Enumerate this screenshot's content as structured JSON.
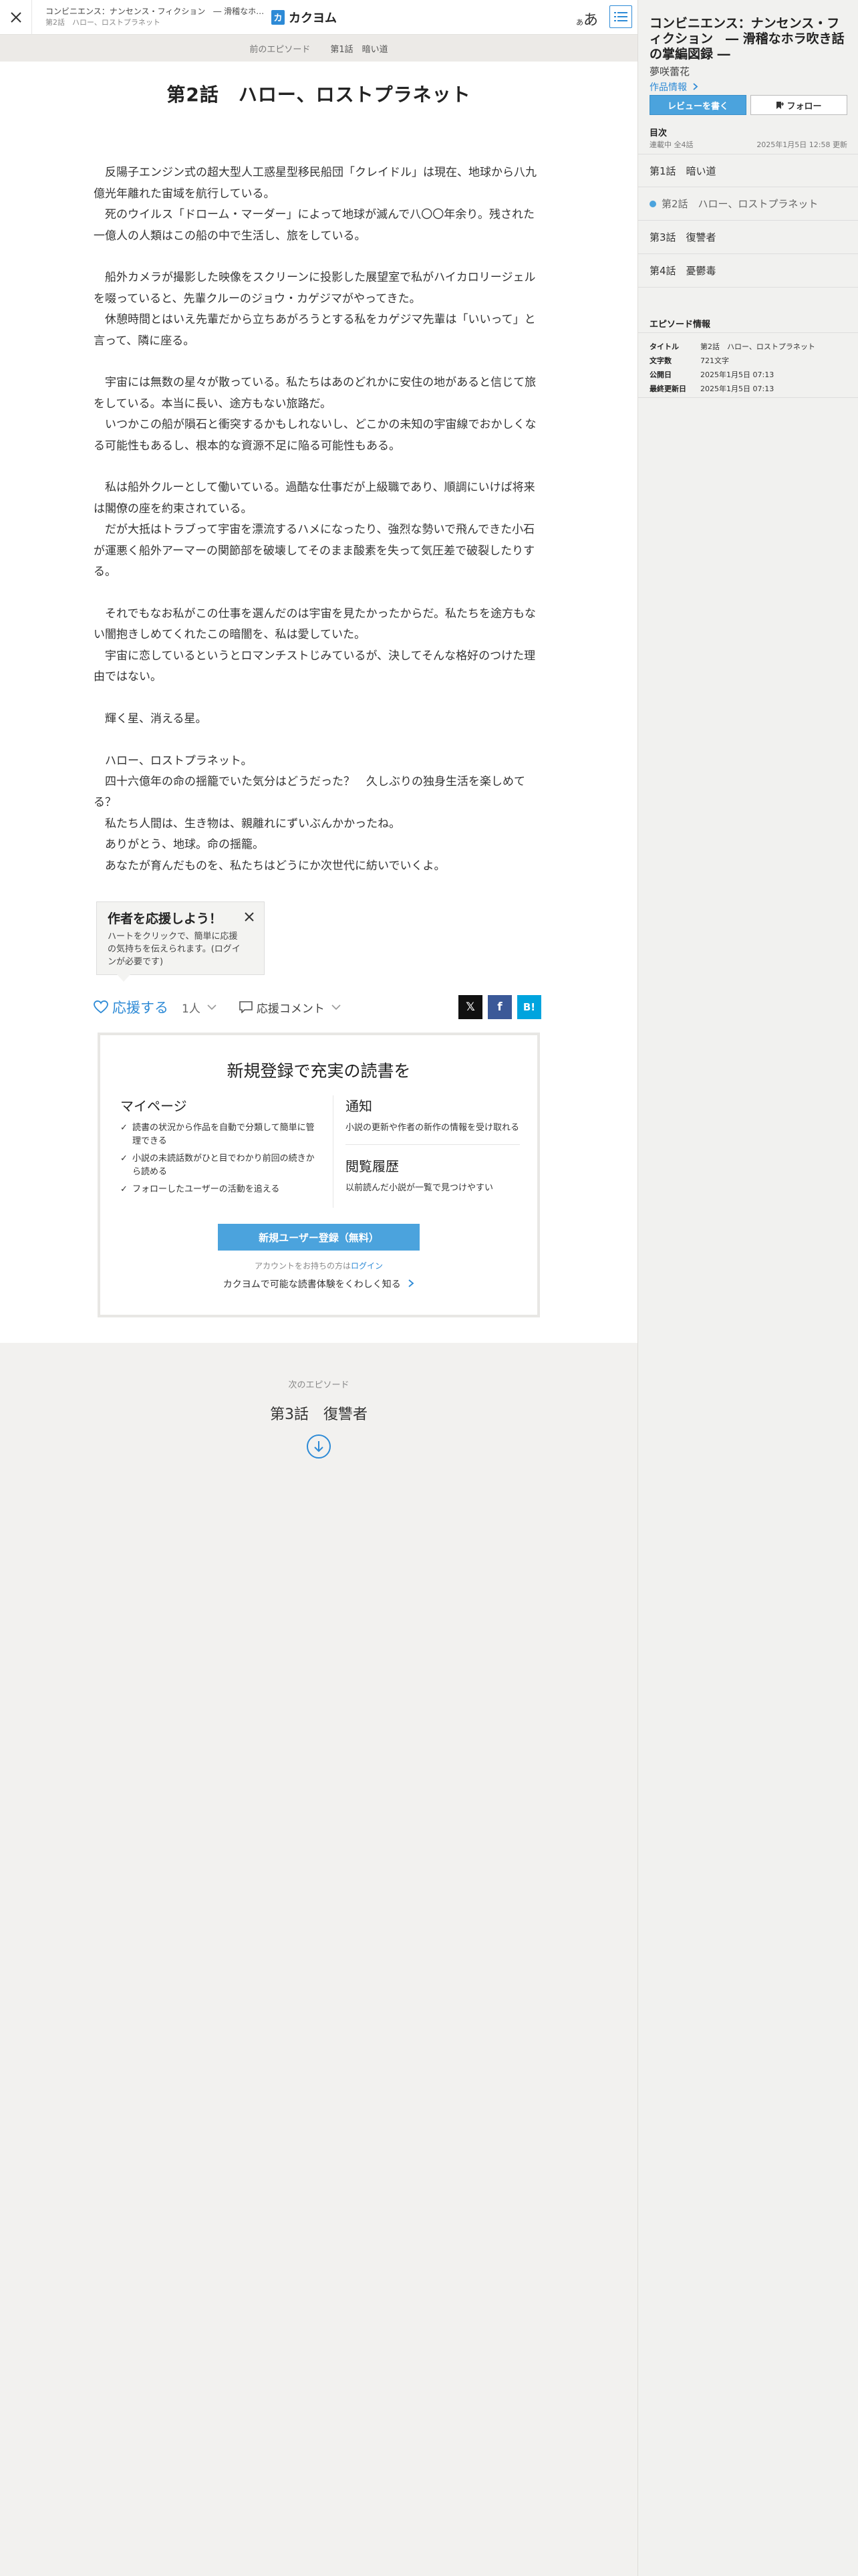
{
  "header": {
    "work_title": "コンビニエンス：ナンセンス・フィクション　― 滑稽なホラ吹き話の掌編図録 ―",
    "episode_crumb": "第2話　ハロー、ロストプラネット",
    "logo_text": "カクヨム",
    "font_button_small": "あ",
    "font_button_large": "あ"
  },
  "prev_episode": {
    "label": "前のエピソード",
    "title": "第1話　暗い道"
  },
  "episode": {
    "title": "第2話　ハロー、ロストプラネット",
    "paragraphs": [
      "",
      "　反陽子エンジン式の超大型人工惑星型移民船団「クレイドル」は現在、地球から八九億光年離れた宙域を航行している。",
      "　死のウイルス「ドローム・マーダー」によって地球が滅んで八〇〇年余り。残された一億人の人類はこの船の中で生活し、旅をしている。",
      "",
      "　船外カメラが撮影した映像をスクリーンに投影した展望室で私がハイカロリージェルを啜っていると、先輩クルーのジョウ・カゲジマがやってきた。",
      "　休憩時間とはいえ先輩だから立ちあがろうとする私をカゲジマ先輩は「いいって」と言って、隣に座る。",
      "",
      "　宇宙には無数の星々が散っている。私たちはあのどれかに安住の地があると信じて旅をしている。本当に長い、途方もない旅路だ。",
      "　いつかこの船が隕石と衝突するかもしれないし、どこかの未知の宇宙線でおかしくなる可能性もあるし、根本的な資源不足に陥る可能性もある。",
      "",
      "　私は船外クルーとして働いている。過酷な仕事だが上級職であり、順調にいけば将来は閣僚の座を約束されている。",
      "　だが大抵はトラブって宇宙を漂流するハメになったり、強烈な勢いで飛んできた小石が運悪く船外アーマーの関節部を破壊してそのまま酸素を失って気圧差で破裂したりする。",
      "",
      "　それでもなお私がこの仕事を選んだのは宇宙を見たかったからだ。私たちを途方もない闇抱きしめてくれたこの暗闇を、私は愛していた。",
      "　宇宙に恋しているというとロマンチストじみているが、決してそんな格好のつけた理由ではない。",
      "",
      "　輝く星、消える星。",
      "",
      "　ハロー、ロストプラネット。",
      "　四十六億年の命の揺籠でいた気分はどうだった？　久しぶりの独身生活を楽しめてる？",
      "　私たち人間は、生き物は、親離れにずいぶんかかったね。",
      "　ありがとう、地球。命の揺籠。",
      "　あなたが育んだものを、私たちはどうにか次世代に紡いでいくよ。"
    ]
  },
  "cheer_popup": {
    "title": "作者を応援しよう！",
    "body": "ハートをクリックで、簡単に応援の気持ちを伝えられます。(ログインが必要です)"
  },
  "actions": {
    "cheer_label": "応援する",
    "cheer_count": "1人",
    "comment_label": "応援コメント",
    "share_x": "𝕏",
    "share_fb": "f",
    "share_hatena": "B!"
  },
  "register": {
    "title": "新規登録で充実の読書を",
    "mypage_heading": "マイページ",
    "mypage_items": [
      "読書の状況から作品を自動で分類して簡単に管理できる",
      "小説の未読話数がひと目でわかり前回の続きから読める",
      "フォローしたユーザーの活動を追える"
    ],
    "notify_heading": "通知",
    "notify_text": "小説の更新や作者の新作の情報を受け取れる",
    "history_heading": "閲覧履歴",
    "history_text": "以前読んだ小説が一覧で見つけやすい",
    "button_label": "新規ユーザー登録（無料）",
    "login_prefix": "アカウントをお持ちの方は",
    "login_link": "ログイン",
    "more_link": "カクヨムで可能な読書体験をくわしく知る"
  },
  "next_episode": {
    "label": "次のエピソード",
    "title": "第3話　復讐者"
  },
  "sidebar": {
    "work_title": "コンビニエンス：ナンセンス・フィクション　― 滑稽なホラ吹き話の掌編図録 ―",
    "author": "夢咲蕾花",
    "work_info_link": "作品情報",
    "review_button": "レビューを書く",
    "follow_button": "フォロー",
    "toc_heading": "目次",
    "toc_status": "連載中 全4話",
    "toc_updated": "2025年1月5日 12:58 更新",
    "toc_items": [
      {
        "label": "第1話　暗い道"
      },
      {
        "label": "第2話　ハロー、ロストプラネット"
      },
      {
        "label": "第3話　復讐者"
      },
      {
        "label": "第4話　憂鬱毒"
      }
    ],
    "episode_info_heading": "エピソード情報",
    "episode_info": [
      {
        "key": "タイトル",
        "value": "第2話　ハロー、ロストプラネット"
      },
      {
        "key": "文字数",
        "value": "721文字"
      },
      {
        "key": "公開日",
        "value": "2025年1月5日 07:13"
      },
      {
        "key": "最終更新日",
        "value": "2025年1月5日 07:13"
      }
    ]
  },
  "colors": {
    "accent": "#2d8ad6",
    "button_blue": "#4ba3dd",
    "background": "#f2f1ef"
  }
}
